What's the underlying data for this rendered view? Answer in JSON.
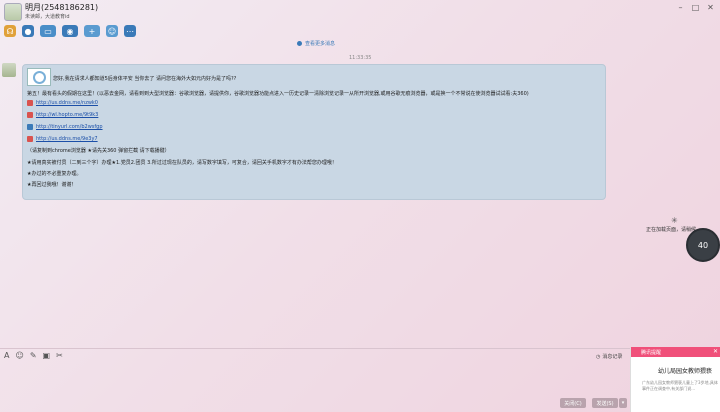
{
  "window": {
    "title": "明月(2548186281)",
    "subtitle": "未读邮，大道教育id",
    "controls": [
      "minimize-icon",
      "maximize-icon",
      "close-icon"
    ]
  },
  "toolbar": [
    "voice-icon",
    "video-icon",
    "folder-icon",
    "remote-icon",
    "add-contact-icon",
    "group-icon",
    "more-icon"
  ],
  "chat": {
    "view_more": "查看更多消息",
    "timestamp": "11:33:35",
    "message": {
      "line1": "您好,我在请求人都知道5后身体平安 当你去了 请问您在海外大如元内好为是了吗??",
      "line2": "第五！最有看头的假期在这里！(以恶去金网，请看到到大型浏览器：谷歌浏览器，请提供你，谷歌浏览器功能点进入一历史记录一清除浏览记录一从所开浏览器,或用谷歌无痕浏览器，或是换一个不常说在使浏览器试试看:夫360)",
      "links": [
        {
          "url": "http://us.ddns.me/nzwk0",
          "color": "#d9534f"
        },
        {
          "url": "http://wl.hopto.me/9t9k3",
          "color": "#d9534f"
        },
        {
          "url": "http://tinyurl.com/b2wsfgp",
          "color": "#3a7ab8"
        },
        {
          "url": "http://us.ddns.me/9e3y7",
          "color": "#d9534f"
        }
      ],
      "tail": [
        "（请复制到chrome浏览器 ★请先关360 弹窗拦截 请下载播键）",
        "★请用真实被付员（二到三个字）办理★1.党员2.团员 3.所过过现在队员的，请写数字填写，可复合，请回关手机数字才有办法帮您办理哦！",
        "★办过的不必重复办理。",
        "★再回过我哦！谢谢！"
      ]
    }
  },
  "loading": {
    "text": "正在加载页面，请稍候...",
    "gauge": "40"
  },
  "input_toolbar": [
    "font-icon",
    "emoji-icon",
    "edit-icon",
    "image-icon",
    "screenshot-icon"
  ],
  "history_label": "消息记录",
  "buttons": {
    "close": "关闭(C)",
    "send": "发送(S)"
  },
  "popup": {
    "header": "腾讯提醒",
    "title": "幼儿局园女教师猥亵",
    "body": "广东幼儿园女教师猥亵儿童上了3岁地,具体事件正在调查中,有关部门说..."
  }
}
